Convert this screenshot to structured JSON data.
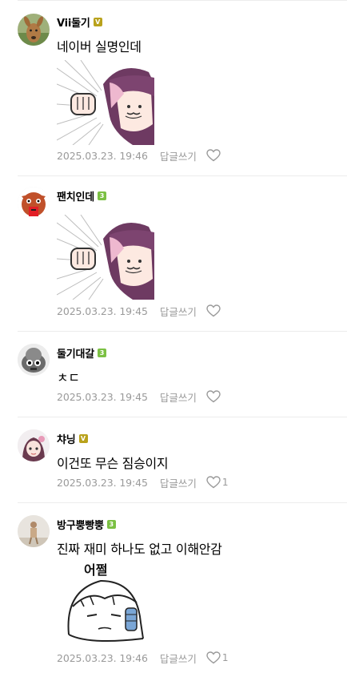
{
  "comments": [
    {
      "nickname": "Vii둘기",
      "badge": "V",
      "badge_color": "#b9a21c",
      "text": "네이버 실명인데",
      "sticker": "purple-hair-anime-punch-sticker",
      "time": "2025.03.23. 19:46",
      "reply_label": "답글쓰기",
      "like_count": ""
    },
    {
      "nickname": "팬치인데",
      "badge": "3",
      "badge_color": "#7bc043",
      "text": "",
      "sticker": "purple-hair-anime-punch-sticker",
      "time": "2025.03.23. 19:45",
      "reply_label": "답글쓰기",
      "like_count": ""
    },
    {
      "nickname": "둘기대갈",
      "badge": "3",
      "badge_color": "#7bc043",
      "text": "ㅊㄷ",
      "time": "2025.03.23. 19:45",
      "reply_label": "답글쓰기",
      "like_count": ""
    },
    {
      "nickname": "챠닝",
      "badge": "V",
      "badge_color": "#b9a21c",
      "text": "이건또 무슨 짐승이지",
      "time": "2025.03.23. 19:45",
      "reply_label": "답글쓰기",
      "like_count": "1"
    },
    {
      "nickname": "방구뿡빵뿡",
      "badge": "3",
      "badge_color": "#7bc043",
      "text": "진짜 재미 하나도 없고 이해안감",
      "sticker": "doodle-girl-sticker",
      "sticker_text": "어쩔",
      "time": "2025.03.23. 19:46",
      "reply_label": "답글쓰기",
      "like_count": "1"
    }
  ]
}
